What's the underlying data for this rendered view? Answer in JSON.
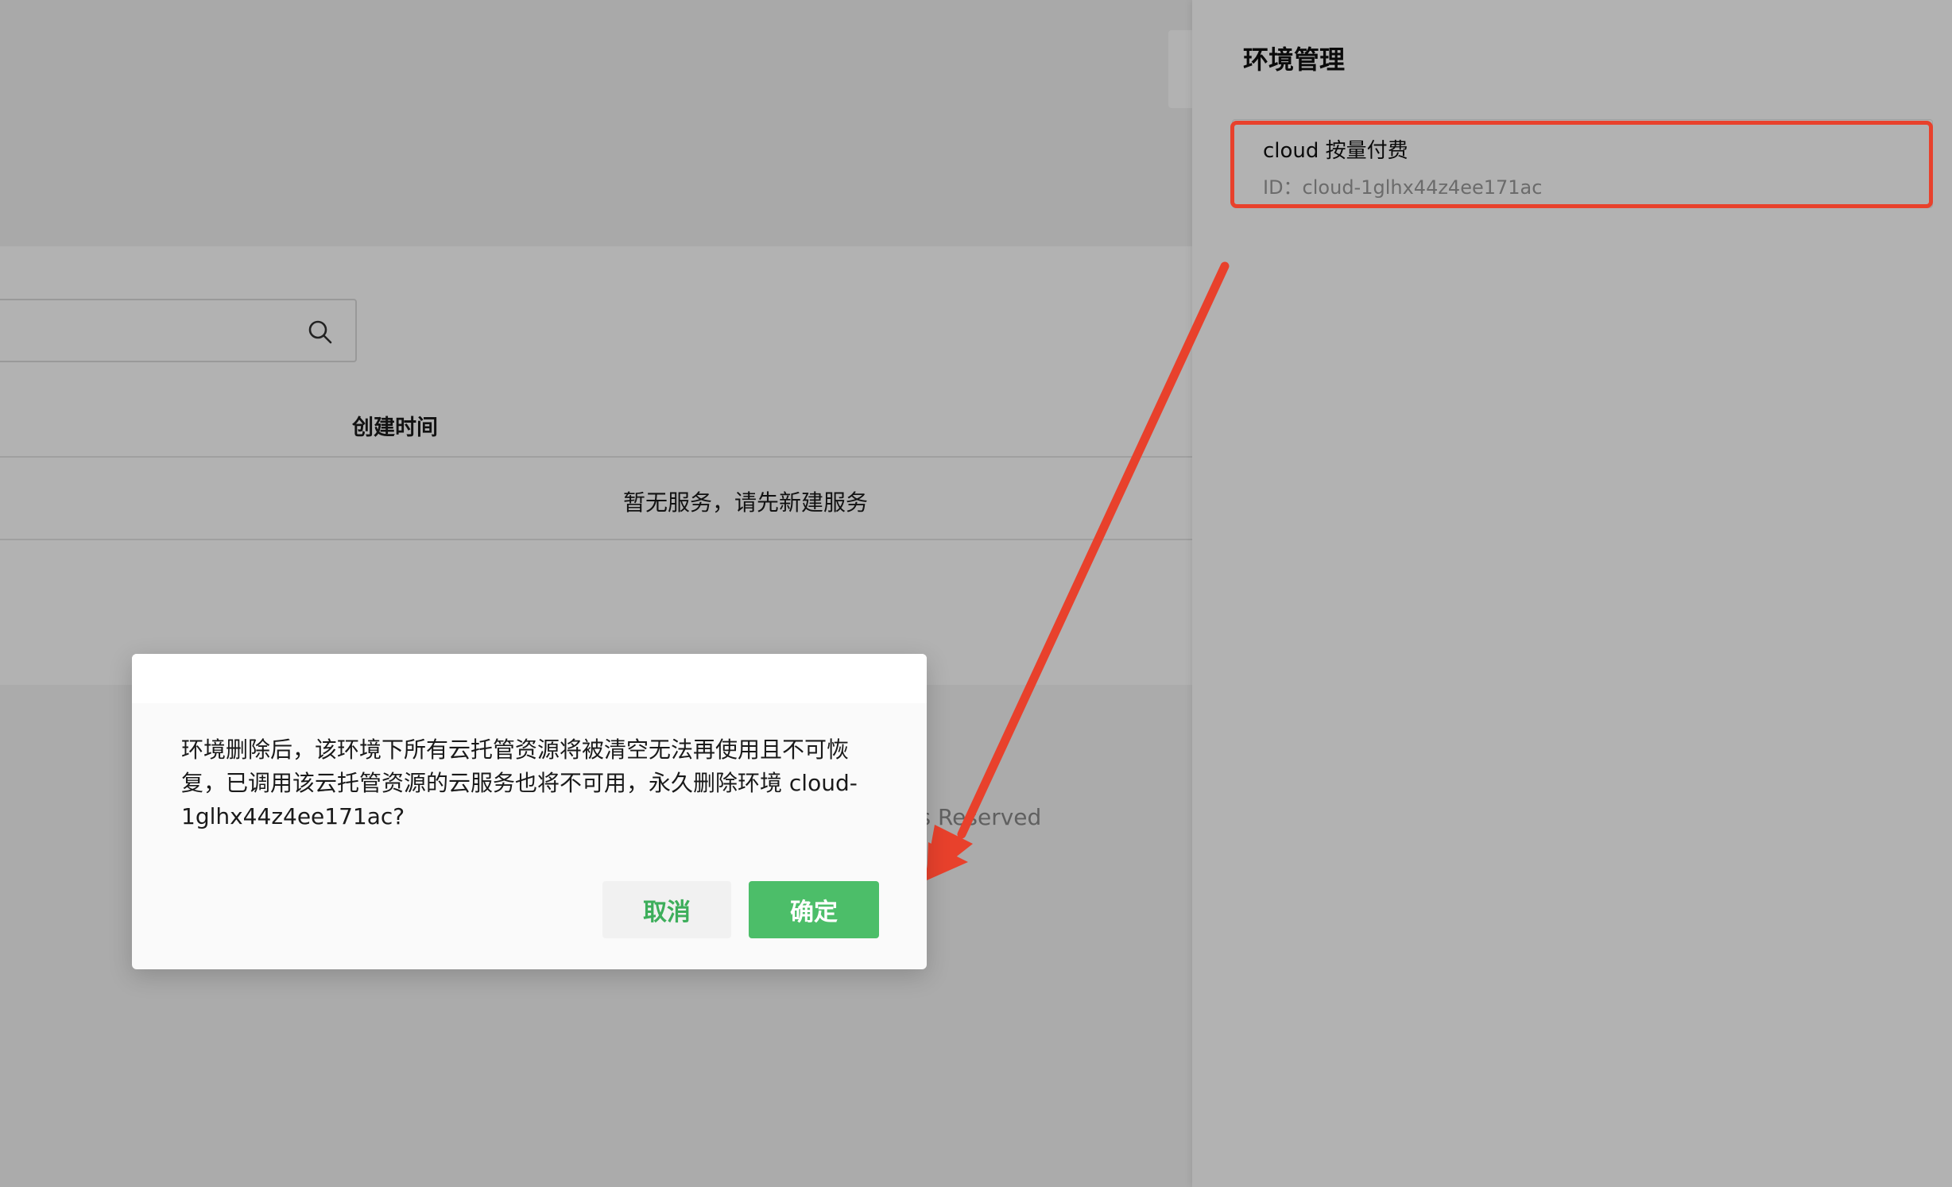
{
  "main": {
    "table": {
      "column_header": "创建时间",
      "empty_text": "暂无服务，请先新建服务"
    },
    "footer_text": "ghts Reserved"
  },
  "drawer": {
    "title": "环境管理",
    "env_item": {
      "name": "cloud 按量付费",
      "id_text": "ID：cloud-1glhx44z4ee171ac"
    }
  },
  "dialog": {
    "message": "环境删除后，该环境下所有云托管资源将被清空无法再使用且不可恢复，已调用该云托管资源的云服务也将不可用，永久删除环境 cloud-1glhx44z4ee171ac?",
    "cancel_label": "取消",
    "ok_label": "确定"
  },
  "colors": {
    "annotation_red": "#e8412c",
    "primary_green": "#4cbe69",
    "cancel_text_green": "#3dae5b"
  },
  "icons": [
    "search-icon"
  ]
}
